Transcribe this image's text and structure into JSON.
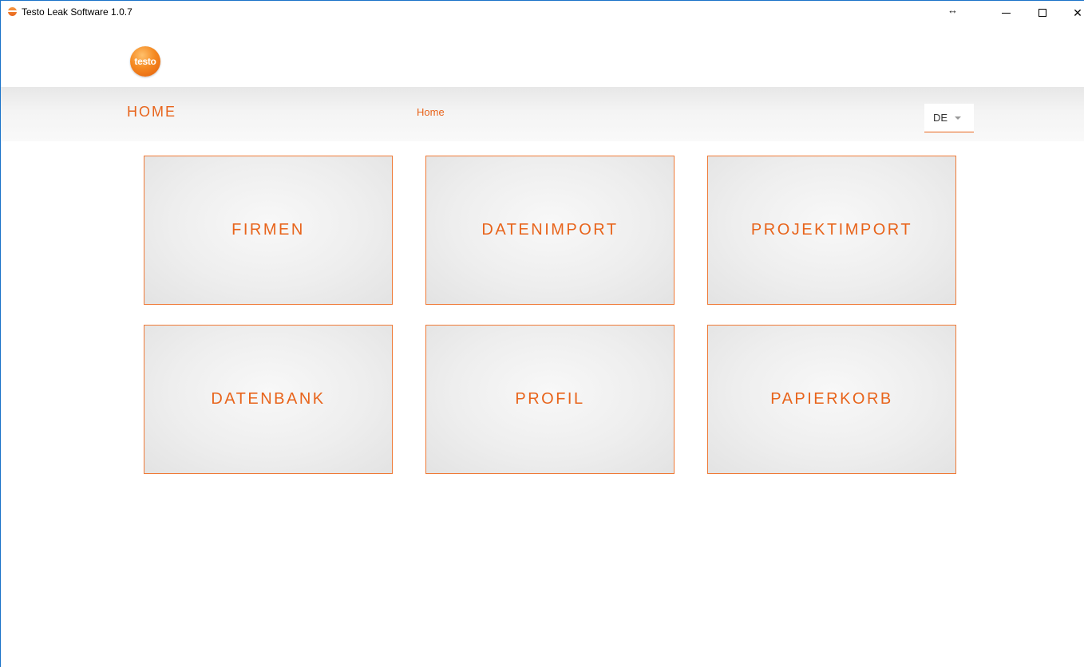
{
  "window": {
    "title": "Testo Leak Software 1.0.7",
    "resize_glyph": "↔",
    "controls": {
      "close_glyph": "✕"
    }
  },
  "logo": {
    "text": "testo"
  },
  "nav": {
    "heading": "HOME",
    "breadcrumb": "Home",
    "language": "DE"
  },
  "tiles": [
    {
      "label": "FIRMEN"
    },
    {
      "label": "DATENIMPORT"
    },
    {
      "label": "PROJEKTIMPORT"
    },
    {
      "label": "DATENBANK"
    },
    {
      "label": "PROFIL"
    },
    {
      "label": "PAPIERKORB"
    }
  ],
  "colors": {
    "accent": "#e8641b",
    "tile_border": "#ef7a37",
    "window_border": "#1a73c9"
  },
  "icons": {
    "app": "testo-app-icon",
    "minimize": "minimize-icon",
    "maximize": "maximize-icon",
    "close": "close-icon",
    "dropdown": "chevron-down-icon"
  }
}
